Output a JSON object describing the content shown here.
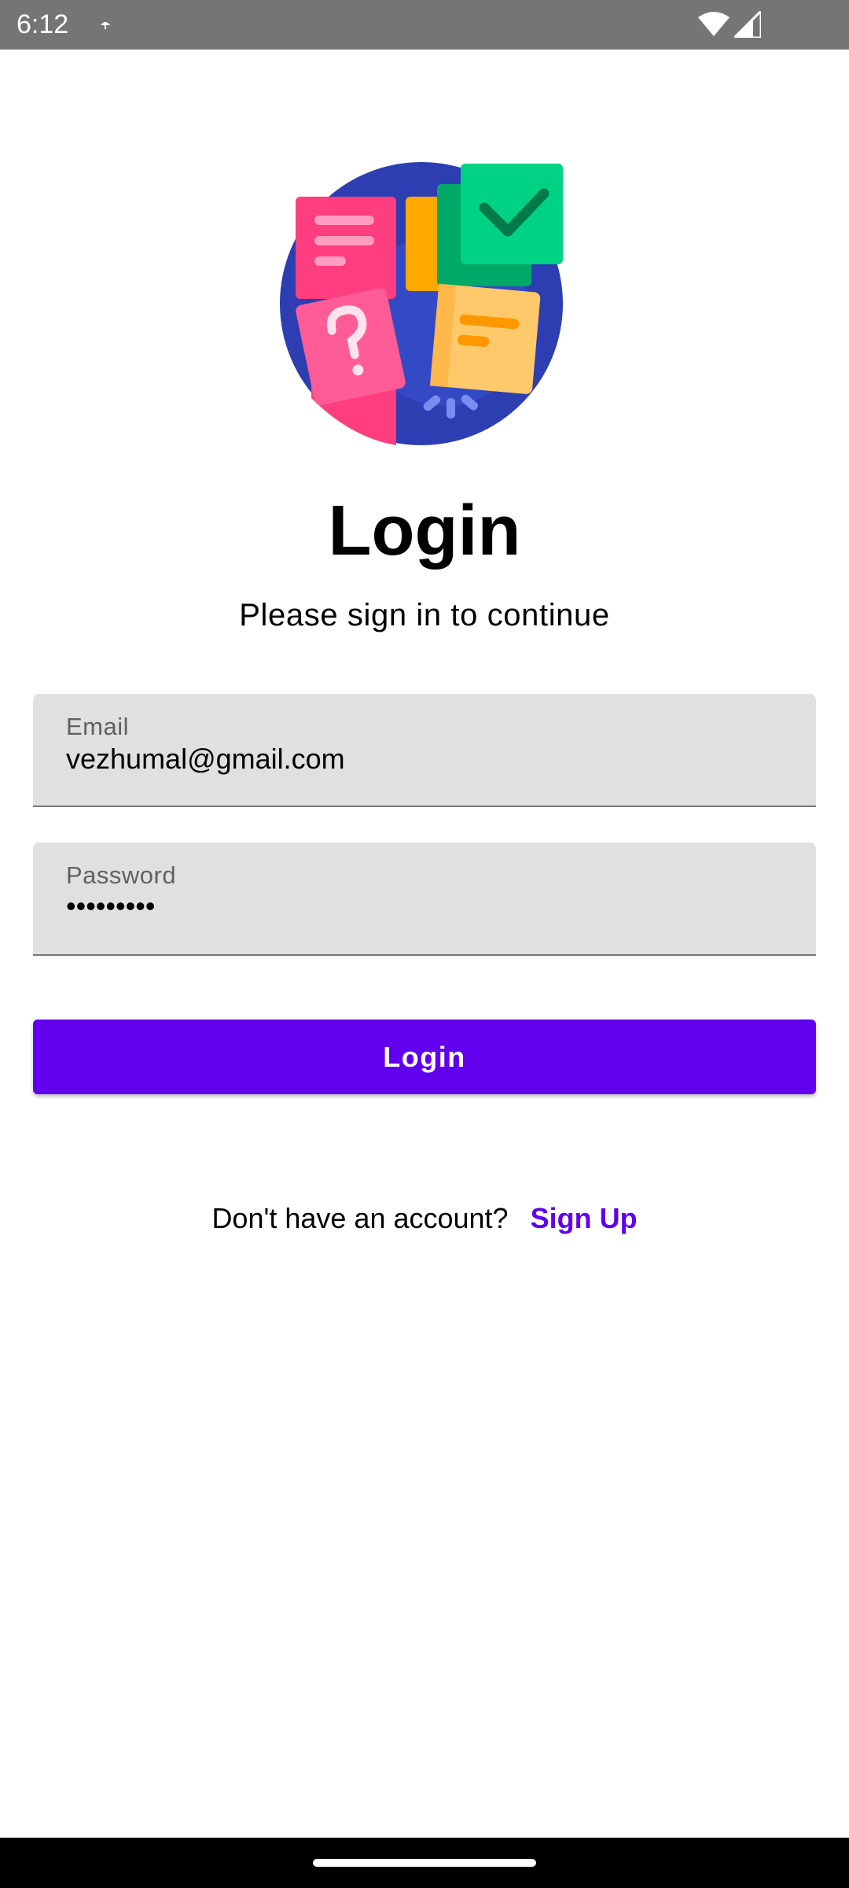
{
  "status_bar": {
    "time": "6:12",
    "icons": [
      "notification-dot-icon",
      "wifi-icon",
      "signal-icon"
    ]
  },
  "hero": {
    "icon": "task-documents-illustration",
    "colors": {
      "circle": "#2d3eb2",
      "pink": "#ff3d7f",
      "orange": "#ffa800",
      "green": "#00d285",
      "yellow": "#ffc96b"
    }
  },
  "header": {
    "title": "Login",
    "subtitle": "Please sign in to continue"
  },
  "form": {
    "email": {
      "label": "Email",
      "value": "vezhumal@gmail.com"
    },
    "password": {
      "label": "Password",
      "value": "•••••••••"
    },
    "submit_label": "Login"
  },
  "footer": {
    "prompt": "Don't have an account?",
    "signup_label": "Sign Up"
  },
  "colors": {
    "accent": "#6200ee",
    "field_background": "#e0e0e0",
    "status_bar": "#757575"
  }
}
